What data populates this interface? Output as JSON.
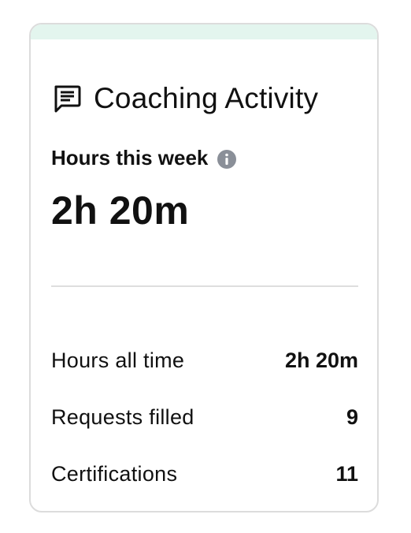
{
  "card": {
    "title": "Coaching Activity",
    "header_icon": "message-square-icon",
    "accent_color": "#e3f5ee",
    "week": {
      "label": "Hours this week",
      "info_icon": "info-icon",
      "value": "2h 20m"
    },
    "stats": [
      {
        "label": "Hours all time",
        "value": "2h 20m"
      },
      {
        "label": "Requests filled",
        "value": "9"
      },
      {
        "label": "Certifications",
        "value": "11"
      }
    ]
  }
}
